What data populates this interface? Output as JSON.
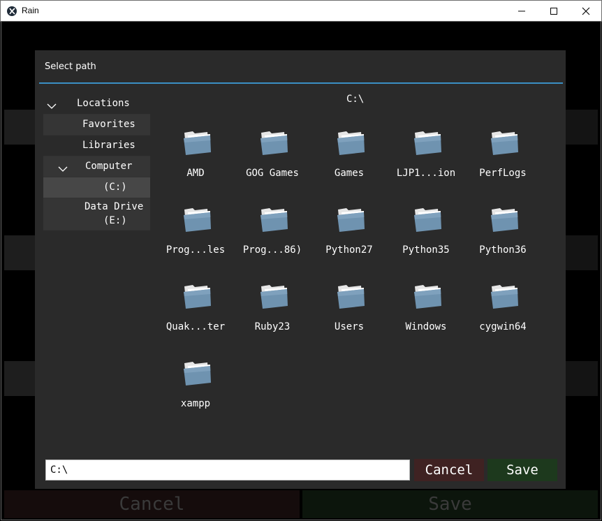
{
  "window": {
    "title": "Rain",
    "minimize_icon": "minimize-icon",
    "maximize_icon": "maximize-icon",
    "close_icon": "close-icon"
  },
  "background": {
    "cancel_label": "Cancel",
    "save_label": "Save"
  },
  "dialog": {
    "title": "Select path",
    "current_path": "C:\\",
    "tree": [
      {
        "label": "Locations",
        "expanded": true
      },
      {
        "label": "Favorites"
      },
      {
        "label": "Libraries"
      },
      {
        "label": "Computer",
        "expanded": true
      },
      {
        "label": "(C:)",
        "selected": true
      },
      {
        "label_line1": "Data Drive",
        "label_line2": "(E:)"
      }
    ],
    "folders": [
      "AMD",
      "GOG Games",
      "Games",
      "LJP1...ion",
      "PerfLogs",
      "Prog...les",
      "Prog...86)",
      "Python27",
      "Python35",
      "Python36",
      "Quak...ter",
      "Ruby23",
      "Users",
      "Windows",
      "cygwin64",
      "xampp"
    ],
    "path_input_value": "C:\\",
    "cancel_label": "Cancel",
    "save_label": "Save"
  },
  "colors": {
    "accent_rule": "#3a8fc4",
    "cancel_bg": "#4a2424",
    "save_bg": "#1e3a1e",
    "dialog_bg": "#2a2a2a",
    "folder_blue": "#6f93b0"
  }
}
